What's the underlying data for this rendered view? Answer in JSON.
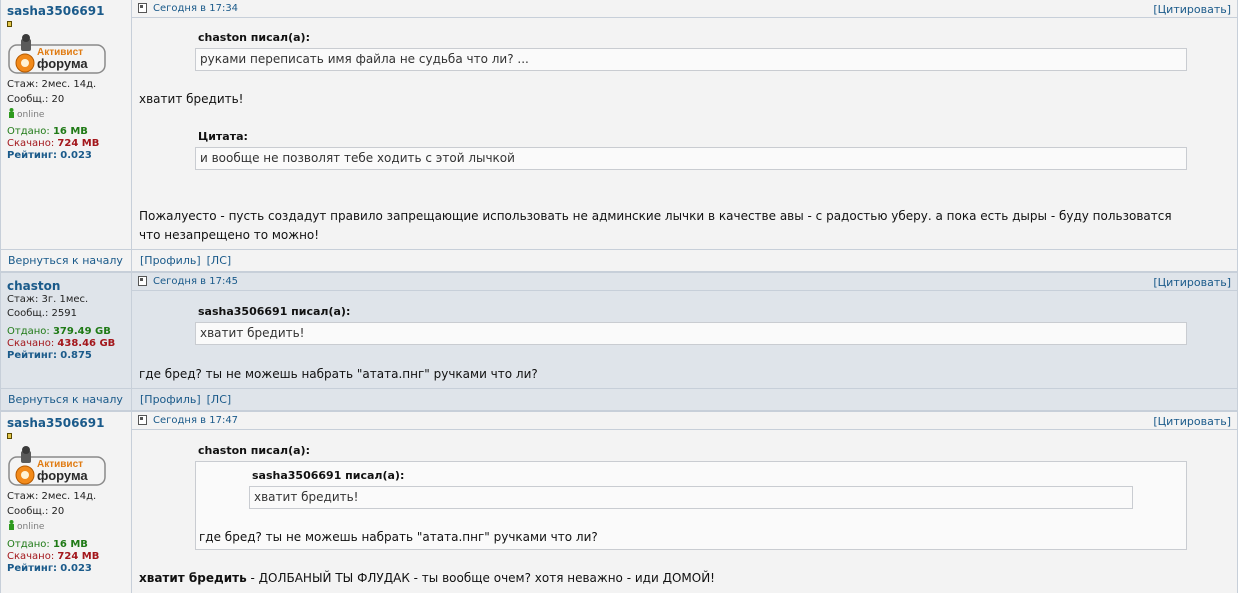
{
  "posts": [
    {
      "username": "sasha3506691",
      "badge_line1": "Активист",
      "badge_line2": "форума",
      "tenure": "Стаж: 2мес. 14д.",
      "messages": "Сообщ.: 20",
      "online": "online",
      "uploaded_label": "Отдано:",
      "uploaded_value": "16 MB",
      "downloaded_label": "Скачано:",
      "downloaded_value": "724 MB",
      "rating_label": "Рейтинг:",
      "rating_value": "0.023",
      "date": "Сегодня в 17:34",
      "quote_button": "[Цитировать]",
      "quote1_author": "chaston писал(а):",
      "quote1_text": "руками переписать имя файла не судьба что ли? ...",
      "text1": "хватит бредить!",
      "quote2_author": "Цитата:",
      "quote2_text": "и вообще не позволят тебе ходить с этой лычкой",
      "text2_line1": "Пожалуесто - пусть создадут правило запрещающие использовать не админские лычки в качестве авы - с радостью уберу. а пока есть дыры - буду пользоватся",
      "text2_line2": "что незапрещено то можно!"
    },
    {
      "username": "chaston",
      "tenure": "Стаж: 3г. 1мес.",
      "messages": "Сообщ.: 2591",
      "uploaded_label": "Отдано:",
      "uploaded_value": "379.49 GB",
      "downloaded_label": "Скачано:",
      "downloaded_value": "438.46 GB",
      "rating_label": "Рейтинг:",
      "rating_value": "0.875",
      "date": "Сегодня в 17:45",
      "quote_button": "[Цитировать]",
      "quote1_author": "sasha3506691 писал(а):",
      "quote1_text": "хватит бредить!",
      "text1": "где бред? ты не можешь набрать \"атата.пнг\" ручками что ли?"
    },
    {
      "username": "sasha3506691",
      "badge_line1": "Активист",
      "badge_line2": "форума",
      "tenure": "Стаж: 2мес. 14д.",
      "messages": "Сообщ.: 20",
      "online": "online",
      "uploaded_label": "Отдано:",
      "uploaded_value": "16 MB",
      "downloaded_label": "Скачано:",
      "downloaded_value": "724 MB",
      "rating_label": "Рейтинг:",
      "rating_value": "0.023",
      "date": "Сегодня в 17:47",
      "quote_button": "[Цитировать]",
      "quote1_author": "chaston писал(а):",
      "nested_author": "sasha3506691 писал(а):",
      "nested_text": "хватит бредить!",
      "quote1_text": "где бред? ты не можешь набрать \"атата.пнг\" ручками что ли?",
      "text_bold": "хватит бредить",
      "text_rest": " - ДОЛБАНЫЙ ТЫ ФЛУДАК - ты вообще очем? хотя неважно - иди ДОМОЙ!"
    }
  ],
  "footer": {
    "back_to_top": "Вернуться к началу",
    "profile": "[Профиль]",
    "pm": "[ЛС]"
  },
  "colors": {
    "link": "#1a5a8a",
    "uploaded": "#1f7a16",
    "downloaded": "#a3161b",
    "row_light": "#f3f3f3",
    "row_dark": "#dfe4ea",
    "border": "#c7cfd9"
  }
}
